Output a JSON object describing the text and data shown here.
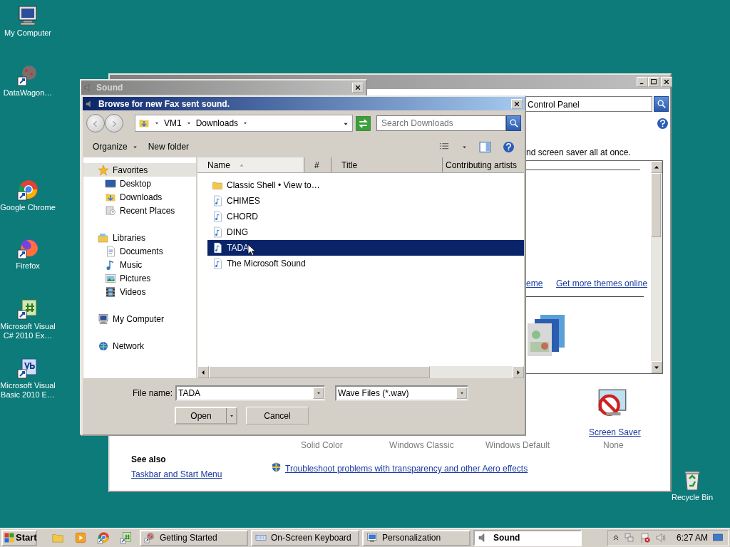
{
  "desktop_icons": [
    {
      "label": "My Computer",
      "kind": "computer"
    },
    {
      "label": "DataWagon…",
      "kind": "app"
    },
    {
      "label": "Google Chrome",
      "kind": "chrome"
    },
    {
      "label": "Firefox",
      "kind": "firefox"
    },
    {
      "label": "Microsoft Visual C# 2010 Ex…",
      "kind": "csharp"
    },
    {
      "label": "Microsoft Visual Basic 2010 E…",
      "kind": "vb"
    },
    {
      "label": "Recycle Bin",
      "kind": "recycle"
    }
  ],
  "personalization_window": {
    "address": "Control Panel",
    "description": "nd screen saver all at once.",
    "links": [
      "eme",
      "Get more themes online"
    ],
    "theme_labels": [
      "Solid Color",
      "Windows Classic",
      "Windows Default"
    ],
    "screen_saver": {
      "label": "Screen Saver",
      "value": "None"
    },
    "see_also": {
      "heading": "See also",
      "links": [
        "Taskbar and Start Menu"
      ]
    },
    "troubleshoot": "Troubleshoot problems with transparency and other Aero effects"
  },
  "sound_window": {
    "title": "Sound"
  },
  "file_dialog": {
    "title": "Browse for new Fax sent sound.",
    "breadcrumb": [
      "VM1",
      "Downloads"
    ],
    "search": {
      "placeholder": "Search Downloads"
    },
    "toolbar": [
      {
        "label": "Organize",
        "dropdown": true
      },
      {
        "label": "New folder",
        "dropdown": false
      }
    ],
    "nav": [
      {
        "label": "Favorites",
        "kind": "star",
        "selected": true,
        "children": [
          {
            "label": "Desktop",
            "kind": "desktop",
            "selected": false
          },
          {
            "label": "Downloads",
            "kind": "downloads",
            "selected": false
          },
          {
            "label": "Recent Places",
            "kind": "recent",
            "selected": false
          }
        ]
      },
      {
        "label": "Libraries",
        "kind": "library",
        "selected": false,
        "children": [
          {
            "label": "Documents",
            "kind": "documents",
            "selected": false
          },
          {
            "label": "Music",
            "kind": "music",
            "selected": false
          },
          {
            "label": "Pictures",
            "kind": "pictures",
            "selected": false
          },
          {
            "label": "Videos",
            "kind": "videos",
            "selected": false
          }
        ]
      },
      {
        "label": "My Computer",
        "kind": "computer",
        "selected": false
      },
      {
        "label": "Network",
        "kind": "network",
        "selected": false
      }
    ],
    "columns": [
      {
        "label": "Name",
        "sorted": true
      },
      {
        "label": "#",
        "sorted": false
      },
      {
        "label": "Title",
        "sorted": false
      },
      {
        "label": "Contributing artists",
        "sorted": false
      }
    ],
    "files": [
      {
        "name": "Classic Shell • View to…",
        "kind": "folder",
        "selected": false
      },
      {
        "name": "CHIMES",
        "kind": "audio",
        "selected": false
      },
      {
        "name": "CHORD",
        "kind": "audio",
        "selected": false
      },
      {
        "name": "DING",
        "kind": "audio",
        "selected": false
      },
      {
        "name": "TADA",
        "kind": "audio",
        "selected": true
      },
      {
        "name": "The Microsoft Sound",
        "kind": "audio",
        "selected": false
      }
    ],
    "file_name_label": "File name:",
    "file_name": "TADA",
    "file_type": "Wave Files (*.wav)",
    "buttons": [
      {
        "label": "Open",
        "kind": "split"
      },
      {
        "label": "Cancel",
        "kind": "plain"
      }
    ]
  },
  "taskbar": {
    "start": "Start",
    "tasks": [
      {
        "label": "Getting Started",
        "kind": "app",
        "selected": false
      },
      {
        "label": "On-Screen Keyboard",
        "kind": "keyboard",
        "selected": false
      },
      {
        "label": "Personalization",
        "kind": "monitor",
        "selected": false
      },
      {
        "label": "Sound",
        "kind": "speaker",
        "selected": true
      }
    ],
    "clock": "6:27 AM"
  }
}
